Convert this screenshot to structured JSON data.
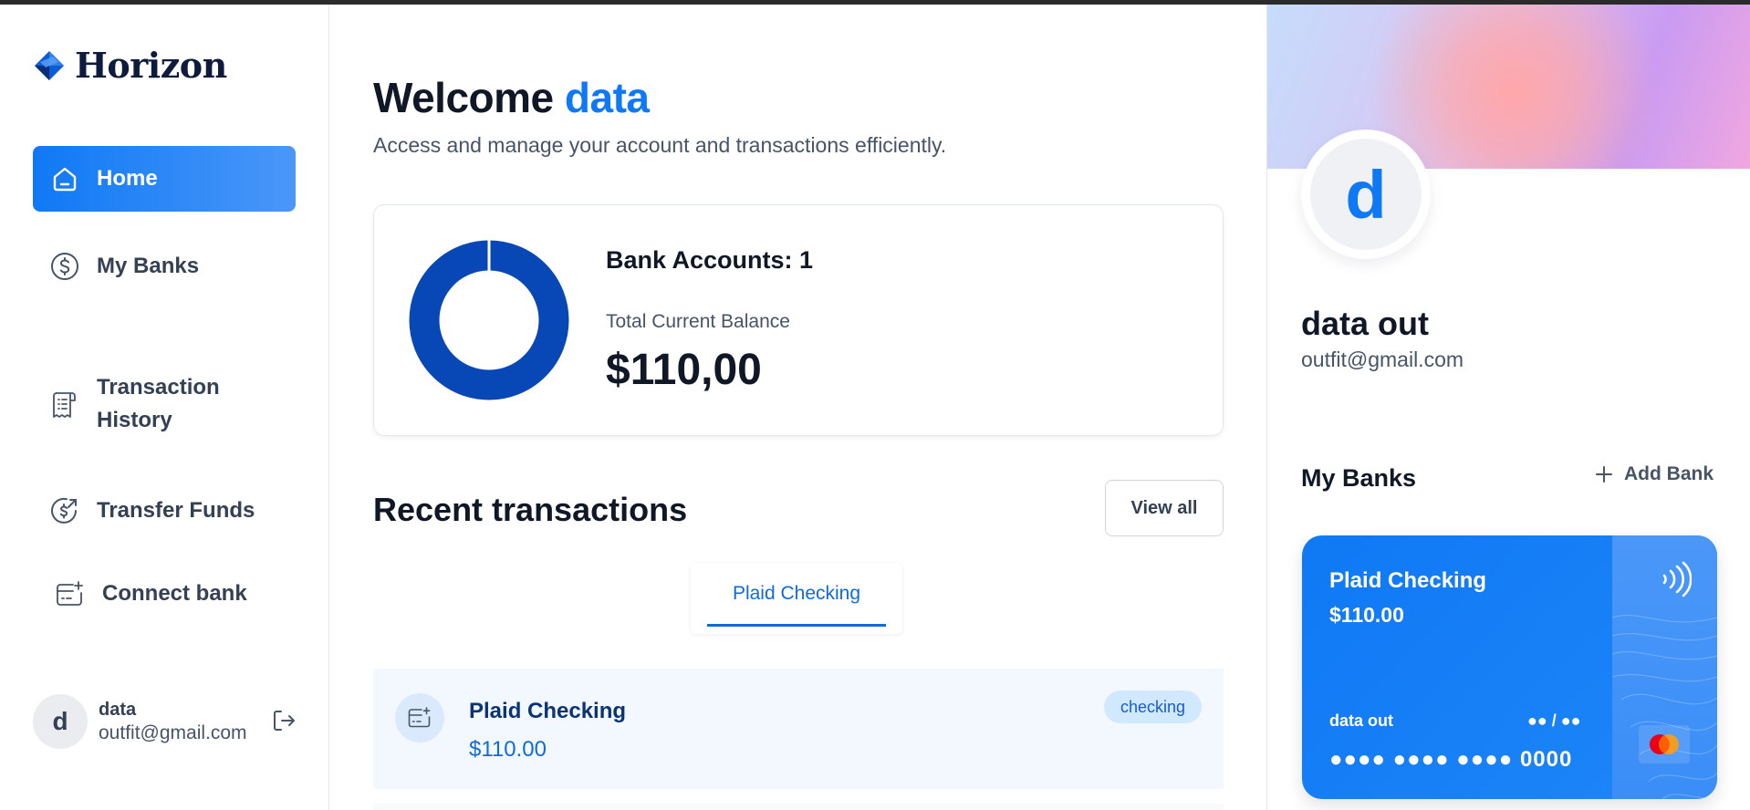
{
  "brand": {
    "name": "Horizon"
  },
  "sidebar": {
    "items": [
      {
        "label": "Home",
        "icon": "home-icon",
        "active": true
      },
      {
        "label": "My Banks",
        "icon": "dollar-circle-icon"
      },
      {
        "label": "Transaction History",
        "icon": "receipt-icon"
      },
      {
        "label": "Transfer Funds",
        "icon": "transfer-funds-icon"
      },
      {
        "label": "Connect bank",
        "icon": "connect-bank-icon"
      }
    ],
    "user": {
      "initial": "d",
      "name": "data",
      "email": "outfit@gmail.com"
    }
  },
  "main": {
    "welcome_prefix": "Welcome",
    "welcome_name": "data",
    "subtitle": "Access and manage your account and transactions efficiently.",
    "balance": {
      "accounts_label": "Bank Accounts: 1",
      "total_label": "Total Current Balance",
      "total_value": "$110,00",
      "donut_color": "#0747b6"
    },
    "recent": {
      "title": "Recent transactions",
      "view_all": "View all",
      "tab": "Plaid Checking",
      "account": {
        "name": "Plaid Checking",
        "amount": "$110.00",
        "type": "checking"
      }
    }
  },
  "profile": {
    "initial": "d",
    "name": "data out",
    "email": "outfit@gmail.com",
    "my_banks_title": "My Banks",
    "add_bank": "Add Bank",
    "card": {
      "name": "Plaid Checking",
      "balance": "$110.00",
      "holder": "data out",
      "expiry": "●● / ●●",
      "number": "●●●● ●●●● ●●●● 0000"
    }
  },
  "colors": {
    "accent": "#0f79f5",
    "text": "#101828",
    "muted": "#475467"
  }
}
